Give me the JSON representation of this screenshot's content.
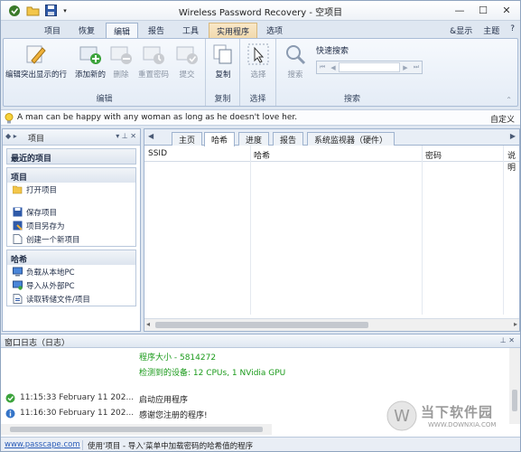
{
  "app": {
    "title": "Wireless Password Recovery - 空项目"
  },
  "ribbon": {
    "tabs": [
      "项目",
      "恢复",
      "编辑",
      "报告",
      "工具",
      "实用程序",
      "选项"
    ],
    "right": {
      "display": "&显示",
      "theme": "主题",
      "help": "?"
    },
    "edit_group": {
      "label": "编辑",
      "buttons": [
        "编辑突出显示的行",
        "添加新的",
        "删除",
        "重置密码",
        "提交"
      ]
    },
    "copy_group": {
      "label": "复制",
      "button": "复制"
    },
    "select_group": {
      "label": "选择",
      "button": "选择"
    },
    "search_group": {
      "label": "搜索",
      "button": "搜索",
      "quick_search": "快速搜索"
    }
  },
  "message": {
    "text": "A man can be happy with any woman as long as he doesn't love her.",
    "custom": "自定义"
  },
  "left_panel": {
    "title": "项目",
    "recent": "最近的项目",
    "project_section": "项目",
    "open": "打开项目",
    "save": "保存项目",
    "save_as": "项目另存为",
    "create": "创建一个新项目",
    "hash_section": "哈希",
    "load_local": "负载从本地PC",
    "import_external": "导入从外部PC",
    "read_file": "读取转储文件/项目"
  },
  "main": {
    "tabs": [
      "主页",
      "哈希",
      "进度",
      "报告",
      "系统监视器（硬件）"
    ],
    "columns": [
      "SSID",
      "哈希",
      "密码",
      "说明"
    ]
  },
  "log": {
    "title": "窗口日志（日志）",
    "lines": [
      {
        "text": "程序大小 - 5814272"
      },
      {
        "text": "检测到的设备:   12 CPUs, 1 NVidia GPU"
      }
    ],
    "entries": [
      {
        "time": "11:15:33 February 11 202...",
        "msg": "启动应用程序"
      },
      {
        "time": "11:16:30 February 11 202...",
        "msg": "感谢您注册的程序!"
      }
    ]
  },
  "status": {
    "link": "www.passcape.com",
    "text": "使用'项目 - 导入'菜单中加载密码的哈希值的程序"
  },
  "watermark": {
    "name": "当下软件园",
    "url": "WWW.DOWNXIA.COM"
  }
}
